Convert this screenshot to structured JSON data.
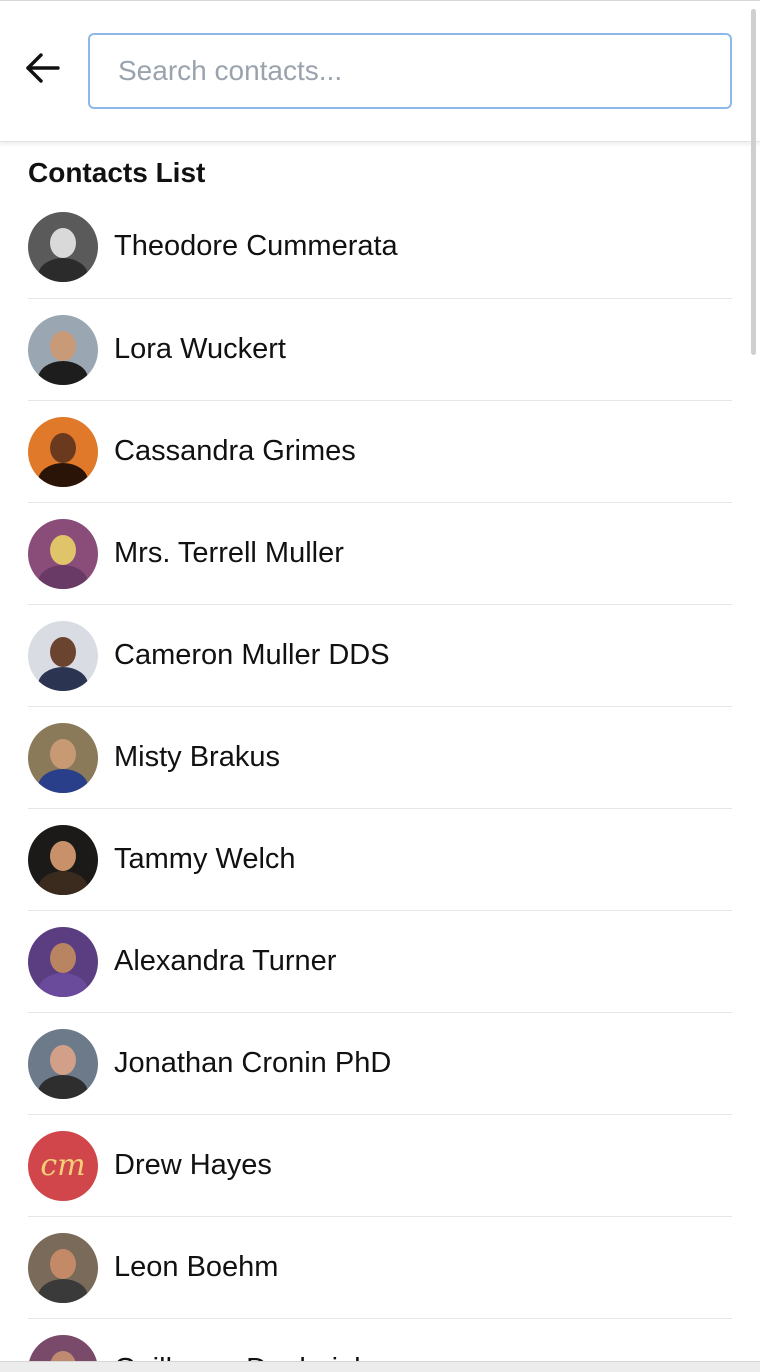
{
  "header": {
    "back_icon": "arrow-left-icon",
    "search_placeholder": "Search contacts...",
    "search_value": "",
    "search_border_color": "#8fb8ea"
  },
  "contacts_section": {
    "title": "Contacts List",
    "items": [
      {
        "name": "Theodore Cummerata",
        "avatar": {
          "bg": "#5a5a5a",
          "face": "#d9d9d9",
          "shoulders": "#2b2b2b"
        }
      },
      {
        "name": "Lora Wuckert",
        "avatar": {
          "bg": "#9aa7b2",
          "face": "#c89a78",
          "shoulders": "#1d1d1d"
        }
      },
      {
        "name": "Cassandra Grimes",
        "avatar": {
          "bg": "#e07a2a",
          "face": "#6b3a1e",
          "shoulders": "#2a1408"
        }
      },
      {
        "name": "Mrs. Terrell Muller",
        "avatar": {
          "bg": "#8a4d7a",
          "face": "#e0c46a",
          "shoulders": "#6a3a66"
        }
      },
      {
        "name": "Cameron Muller DDS",
        "avatar": {
          "bg": "#d9dde3",
          "face": "#6b4430",
          "shoulders": "#2b3552"
        }
      },
      {
        "name": "Misty Brakus",
        "avatar": {
          "bg": "#8a7a5a",
          "face": "#c79a74",
          "shoulders": "#2a3f8a"
        }
      },
      {
        "name": "Tammy Welch",
        "avatar": {
          "bg": "#1c1a18",
          "face": "#c8916a",
          "shoulders": "#3a2b1e"
        }
      },
      {
        "name": "Alexandra Turner",
        "avatar": {
          "bg": "#5b3d82",
          "face": "#b98462",
          "shoulders": "#6a4a9a"
        }
      },
      {
        "name": "Jonathan Cronin PhD",
        "avatar": {
          "bg": "#6c7a8a",
          "face": "#d2a088",
          "shoulders": "#2e2e2e"
        }
      },
      {
        "name": "Drew Hayes",
        "avatar": {
          "bg": "#d1464a",
          "monogram": "cm"
        }
      },
      {
        "name": "Leon Boehm",
        "avatar": {
          "bg": "#7a6a5a",
          "face": "#c48a68",
          "shoulders": "#3a3a3a"
        }
      },
      {
        "name": "Guillermo Denbeigh",
        "avatar": {
          "bg": "#7a4a6a",
          "face": "#c08a70",
          "shoulders": "#3a2030"
        }
      }
    ]
  }
}
